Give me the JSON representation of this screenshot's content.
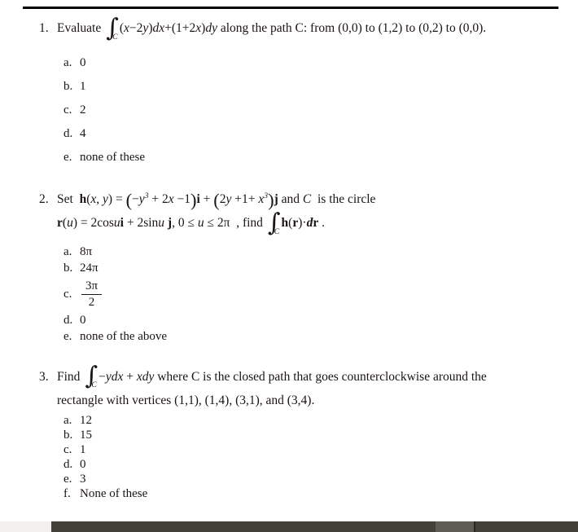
{
  "document": {
    "type": "math-quiz-page",
    "top_rule": true
  },
  "problems": [
    {
      "number": "1.",
      "prompt_prefix": "Evaluate",
      "integral_subscript": "C",
      "integrand": "(x−2y)dx+(1+2x)dy",
      "prompt_suffix": "along the path C: from (0,0) to (1,2) to (0,2) to (0,0).",
      "options": [
        {
          "letter": "a.",
          "text": "0"
        },
        {
          "letter": "b.",
          "text": "1"
        },
        {
          "letter": "c.",
          "text": "2"
        },
        {
          "letter": "d.",
          "text": "4"
        },
        {
          "letter": "e.",
          "text": "none of these"
        }
      ]
    },
    {
      "number": "2.",
      "prompt_prefix": "Set",
      "function_name": "h(x, y)",
      "component_i": "−y³ + 2x − 1",
      "component_j": "2y + 1 + x³",
      "prompt_mid": "and C  is the circle",
      "parametrization": "r(u) = 2 cos u i + 2 sin u j, 0 ≤ u ≤ 2π",
      "find_label": ", find",
      "line_integral": "h(r)·dr .",
      "integral_subscript": "C",
      "options": [
        {
          "letter": "a.",
          "text": "8π"
        },
        {
          "letter": "b.",
          "text": "24π"
        },
        {
          "letter": "c.",
          "text": "",
          "fraction": {
            "numerator": "3π",
            "denominator": "2"
          }
        },
        {
          "letter": "d.",
          "text": "0"
        },
        {
          "letter": "e.",
          "text": "none of the above"
        }
      ]
    },
    {
      "number": "3.",
      "prompt_prefix": "Find",
      "integral_subscript": "C",
      "integrand": "−ydx + xdy",
      "prompt_suffix": "where C is the closed path that goes counterclockwise around the",
      "continuation": "rectangle with vertices (1,1), (1,4), (3,1), and (3,4).",
      "options": [
        {
          "letter": "a.",
          "text": "12"
        },
        {
          "letter": "b.",
          "text": "15"
        },
        {
          "letter": "c.",
          "text": "1"
        },
        {
          "letter": "d.",
          "text": "0"
        },
        {
          "letter": "e.",
          "text": "3"
        },
        {
          "letter": "f.",
          "text": "None of these"
        }
      ]
    }
  ],
  "scrollbar": {
    "orientation": "horizontal",
    "track_color": "#433f39",
    "thumb_color": "#5f5b55"
  }
}
